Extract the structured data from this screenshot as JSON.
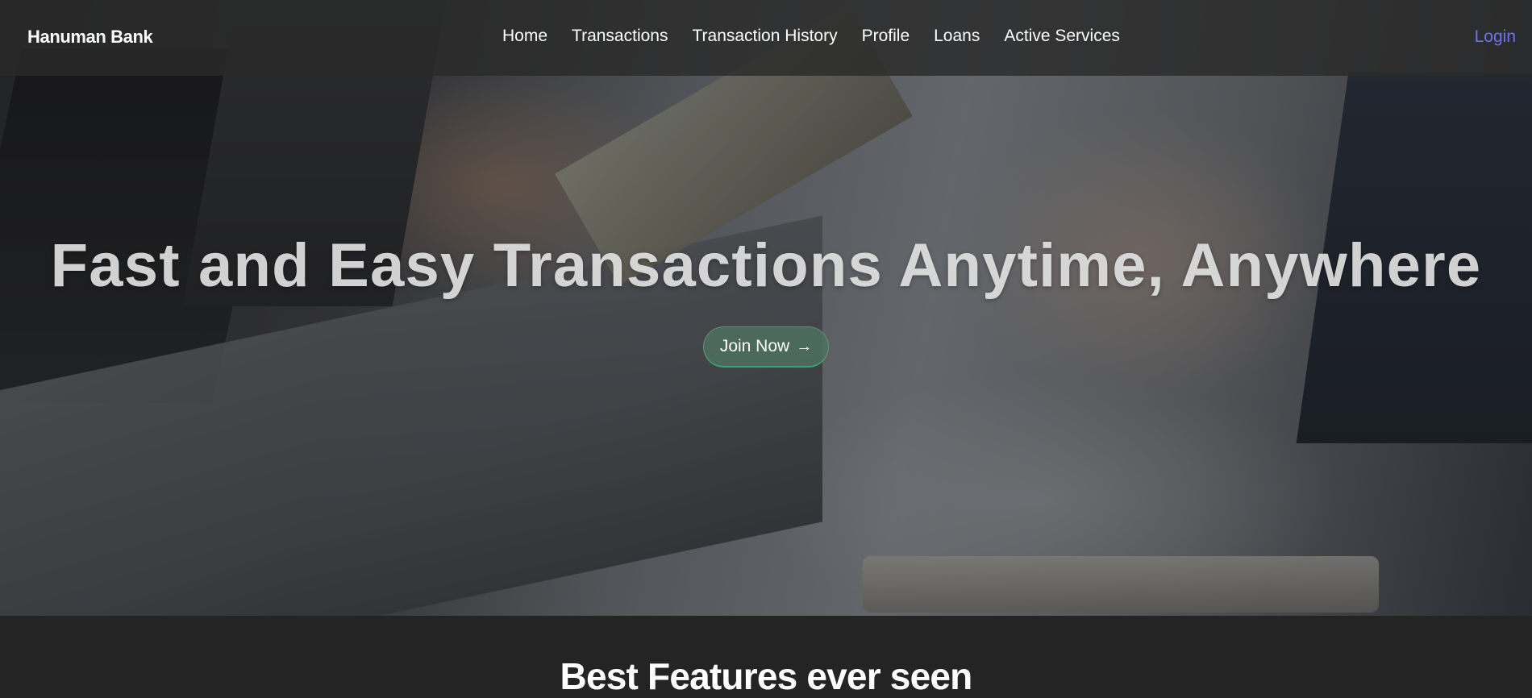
{
  "brand": {
    "name": "Hanuman Bank"
  },
  "nav": {
    "items": [
      {
        "label": "Home"
      },
      {
        "label": "Transactions"
      },
      {
        "label": "Transaction History"
      },
      {
        "label": "Profile"
      },
      {
        "label": "Loans"
      },
      {
        "label": "Active Services"
      }
    ],
    "login_label": "Login"
  },
  "hero": {
    "headline": "Fast and Easy Transactions Anytime, Anywhere",
    "cta_label": "Join Now",
    "cta_icon": "arrow-right-icon"
  },
  "features": {
    "title": "Best Features ever seen"
  },
  "colors": {
    "login_link": "#6b73f2",
    "cta_background": "#4e7060",
    "cta_accent": "#3ea26c",
    "page_background": "#242424"
  }
}
